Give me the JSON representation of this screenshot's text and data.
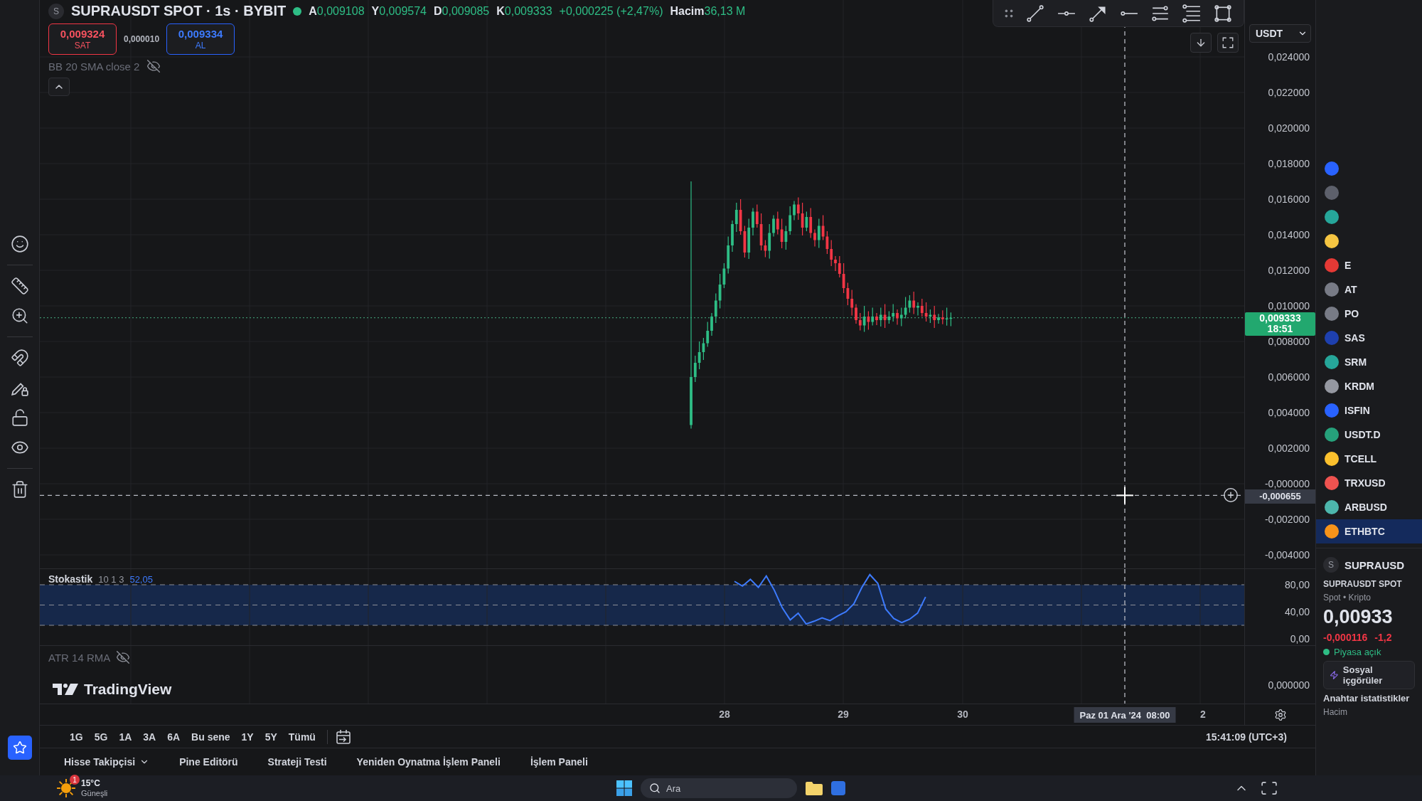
{
  "legend": {
    "symbol_logo": "S",
    "title": "SUPRAUSDT SPOT · 1s · BYBIT",
    "ohlc": [
      {
        "label": "A",
        "value": "0,009108"
      },
      {
        "label": "Y",
        "value": "0,009574"
      },
      {
        "label": "D",
        "value": "0,009085"
      },
      {
        "label": "K",
        "value": "0,009333"
      }
    ],
    "change": "+0,000225 (+2,47%)",
    "volume": {
      "label": "Hacim",
      "value": "36,13 M"
    }
  },
  "trade_buttons": {
    "sell": {
      "price": "0,009324",
      "label": "SAT"
    },
    "spread": "0,000010",
    "buy": {
      "price": "0,009334",
      "label": "AL"
    }
  },
  "indicators": [
    {
      "label": "BB 20 SMA close 2",
      "hidden": true
    }
  ],
  "price_axis": {
    "currency": "USDT",
    "labels": [
      "0,024000",
      "0,022000",
      "0,020000",
      "0,018000",
      "0,016000",
      "0,014000",
      "0,012000",
      "0,010000",
      "0,008000",
      "0,006000",
      "0,004000",
      "0,002000",
      "-0,000000",
      "-0,002000",
      "-0,004000"
    ],
    "last_price": {
      "value": "0,009333",
      "countdown": "18:51"
    },
    "crosshair_value": "-0,000655"
  },
  "stochastic": {
    "name": "Stokastik",
    "params": "10 1 3",
    "value": "52,05",
    "axis_labels": [
      "80,00",
      "40,00",
      "0,00"
    ]
  },
  "atr": {
    "label": "ATR 14 RMA",
    "hidden": true,
    "axis_labels": [
      "0,000000"
    ]
  },
  "brand": "TradingView",
  "time_axis": {
    "labels": [
      "28",
      "29",
      "30",
      "2"
    ],
    "crosshair_label": "Paz 01 Ara '24  08:00"
  },
  "range_buttons": [
    "1G",
    "5G",
    "1A",
    "3A",
    "6A",
    "Bu sene",
    "1Y",
    "5Y",
    "Tümü"
  ],
  "clock": "15:41:09 (UTC+3)",
  "bottom_tabs": [
    {
      "label": "Hisse Takipçisi",
      "has_menu": true
    },
    {
      "label": "Pine Editörü",
      "has_menu": false
    },
    {
      "label": "Strateji Testi",
      "has_menu": false
    },
    {
      "label": "Yeniden Oynatma İşlem Paneli",
      "has_menu": false
    },
    {
      "label": "İşlem Paneli",
      "has_menu": false
    }
  ],
  "watchlist": [
    {
      "color": "#2962ff",
      "selected": false
    },
    {
      "color": "#5d606b",
      "selected": false
    },
    {
      "color": "#26a69a",
      "selected": false
    },
    {
      "color": "#f5c542",
      "selected": false
    },
    {
      "symbol": "E",
      "color": "#e53935",
      "selected": false
    },
    {
      "symbol": "AT",
      "color": "#787b86",
      "selected": false
    },
    {
      "symbol": "PO",
      "color": "#787b86",
      "selected": false
    },
    {
      "symbol": "SAS",
      "color": "#1e40af",
      "selected": false
    },
    {
      "symbol": "SRM",
      "color": "#26a69a",
      "selected": false
    },
    {
      "symbol": "KRDM",
      "color": "#9598a1",
      "selected": false
    },
    {
      "symbol": "ISFIN",
      "color": "#2962ff",
      "selected": false
    },
    {
      "symbol": "USDT.D",
      "color": "#26a17b",
      "selected": false
    },
    {
      "symbol": "TCELL",
      "color": "#fbc02d",
      "selected": false
    },
    {
      "symbol": "TRXUSD",
      "color": "#ef5350",
      "selected": false
    },
    {
      "symbol": "ARBUSD",
      "color": "#4db6ac",
      "selected": false
    },
    {
      "symbol": "ETHBTC",
      "color": "#f7931a",
      "selected": true
    }
  ],
  "symbol_details": {
    "logo": "S",
    "symbol": "SUPRAUSD",
    "name": "SUPRAUSDT SPOT",
    "category": "Spot • Kripto",
    "price": "0,00933",
    "change": "-0,000116",
    "change_percent": "-1,2",
    "market_status": "Piyasa açık",
    "social_button": "Sosyal içgörüler",
    "section_title": "Anahtar istatistikler",
    "stat_label": "Hacim"
  },
  "taskbar": {
    "weather": {
      "badge": "1",
      "temperature": "15°C",
      "condition": "Güneşli"
    },
    "search": {
      "placeholder": "Ara"
    }
  }
}
